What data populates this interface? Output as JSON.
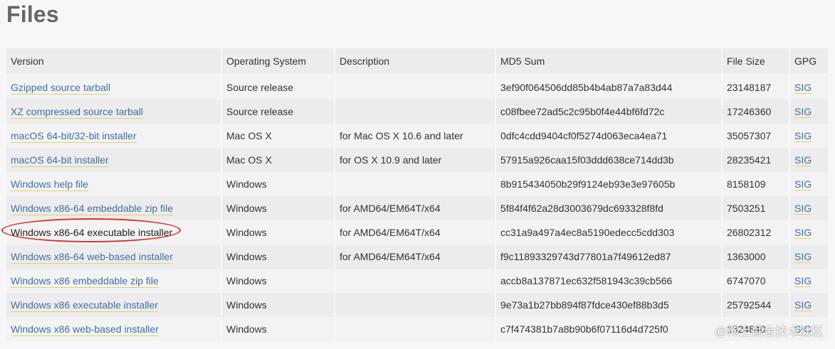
{
  "page": {
    "title": "Files"
  },
  "table": {
    "headers": [
      "Version",
      "Operating System",
      "Description",
      "MD5 Sum",
      "File Size",
      "GPG"
    ],
    "rows": [
      {
        "version": "Gzipped source tarball",
        "os": "Source release",
        "description": "",
        "md5": "3ef90f064506dd85b4b4ab87a7a83d44",
        "size": "23148187",
        "gpg": "SIG"
      },
      {
        "version": "XZ compressed source tarball",
        "os": "Source release",
        "description": "",
        "md5": "c08fbee72ad5c2c95b0f4e44bf6fd72c",
        "size": "17246360",
        "gpg": "SIG"
      },
      {
        "version": "macOS 64-bit/32-bit installer",
        "os": "Mac OS X",
        "description": "for Mac OS X 10.6 and later",
        "md5": "0dfc4cdd9404cf0f5274d063eca4ea71",
        "size": "35057307",
        "gpg": "SIG"
      },
      {
        "version": "macOS 64-bit installer",
        "os": "Mac OS X",
        "description": "for OS X 10.9 and later",
        "md5": "57915a926caa15f03ddd638ce714dd3b",
        "size": "28235421",
        "gpg": "SIG"
      },
      {
        "version": "Windows help file",
        "os": "Windows",
        "description": "",
        "md5": "8b915434050b29f9124eb93e3e97605b",
        "size": "8158109",
        "gpg": "SIG"
      },
      {
        "version": "Windows x86-64 embeddable zip file",
        "os": "Windows",
        "description": "for AMD64/EM64T/x64",
        "md5": "5f84f4f62a28d3003679dc693328f8fd",
        "size": "7503251",
        "gpg": "SIG"
      },
      {
        "version": "Windows x86-64 executable installer",
        "os": "Windows",
        "description": "for AMD64/EM64T/x64",
        "md5": "cc31a9a497a4ec8a5190edecc5cdd303",
        "size": "26802312",
        "gpg": "SIG",
        "highlighted": true
      },
      {
        "version": "Windows x86-64 web-based installer",
        "os": "Windows",
        "description": "for AMD64/EM64T/x64",
        "md5": "f9c11893329743d77801a7f49612ed87",
        "size": "1363000",
        "gpg": "SIG"
      },
      {
        "version": "Windows x86 embeddable zip file",
        "os": "Windows",
        "description": "",
        "md5": "accb8a137871ec632f581943c39cb566",
        "size": "6747070",
        "gpg": "SIG"
      },
      {
        "version": "Windows x86 executable installer",
        "os": "Windows",
        "description": "",
        "md5": "9e73a1b27bb894f87fdce430ef88b3d5",
        "size": "25792544",
        "gpg": "SIG"
      },
      {
        "version": "Windows x86 web-based installer",
        "os": "Windows",
        "description": "",
        "md5": "c7f474381b7a8b90b6f07116d4d725f0",
        "size": "1324840",
        "gpg": "SIG"
      }
    ]
  },
  "watermark": {
    "text": "@稀土掘金技术社区"
  },
  "colors": {
    "link": "#3f6fa8",
    "link_underline": "#e6cf66",
    "annotation_ring": "#d9302a"
  }
}
